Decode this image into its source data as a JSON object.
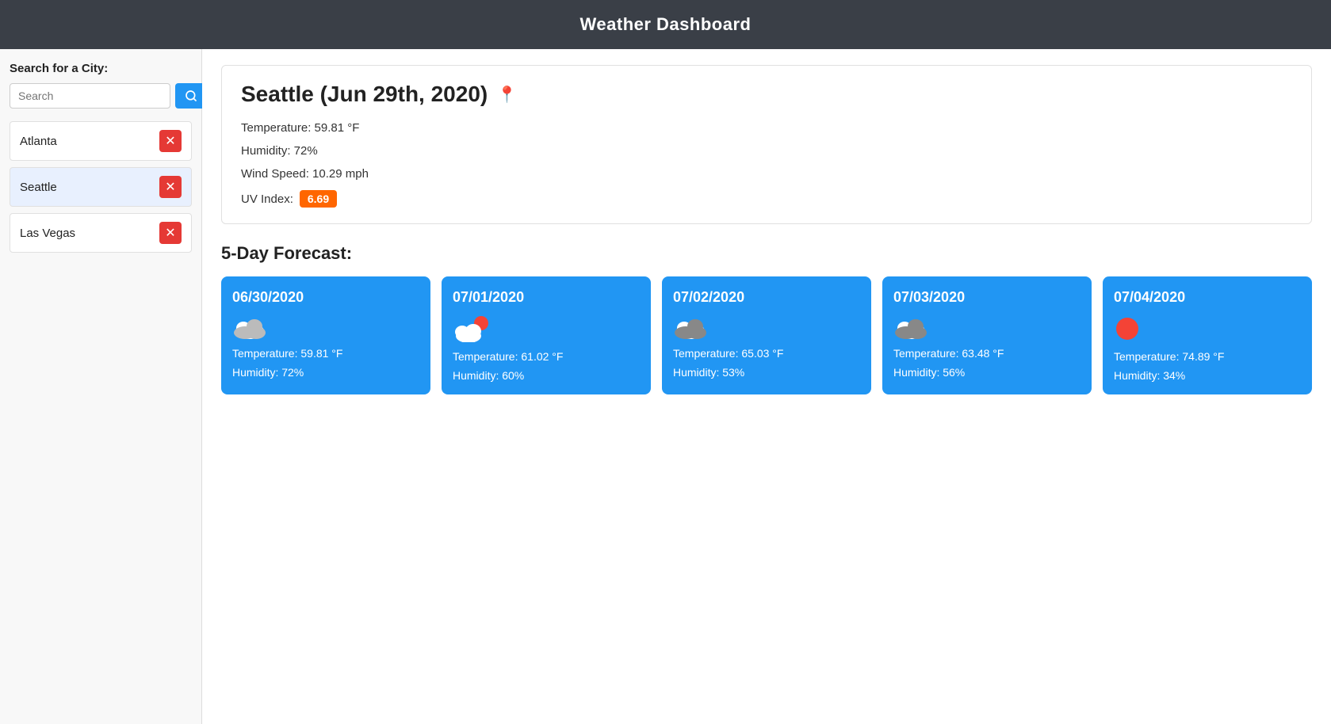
{
  "header": {
    "title": "Weather Dashboard"
  },
  "sidebar": {
    "search_label": "Search for a City:",
    "search_placeholder": "Search",
    "search_button_label": "🔍",
    "cities": [
      {
        "id": "atlanta",
        "name": "Atlanta",
        "active": false
      },
      {
        "id": "seattle",
        "name": "Seattle",
        "active": true
      },
      {
        "id": "las-vegas",
        "name": "Las Vegas",
        "active": false
      }
    ]
  },
  "current_weather": {
    "city_date": "Seattle (Jun 29th, 2020)",
    "temperature": "Temperature: 59.81 °F",
    "humidity": "Humidity: 72%",
    "wind_speed": "Wind Speed: 10.29 mph",
    "uv_label": "UV Index:",
    "uv_value": "6.69"
  },
  "forecast": {
    "title": "5-Day Forecast:",
    "days": [
      {
        "date": "06/30/2020",
        "icon": "cloud",
        "temperature": "Temperature: 59.81 °F",
        "humidity": "Humidity: 72%"
      },
      {
        "date": "07/01/2020",
        "icon": "cloud-sun",
        "temperature": "Temperature: 61.02 °F",
        "humidity": "Humidity: 60%"
      },
      {
        "date": "07/02/2020",
        "icon": "cloud-dark",
        "temperature": "Temperature: 65.03 °F",
        "humidity": "Humidity: 53%"
      },
      {
        "date": "07/03/2020",
        "icon": "cloud-dark",
        "temperature": "Temperature: 63.48 °F",
        "humidity": "Humidity: 56%"
      },
      {
        "date": "07/04/2020",
        "icon": "sun",
        "temperature": "Temperature: 74.89 °F",
        "humidity": "Humidity: 34%"
      }
    ]
  }
}
